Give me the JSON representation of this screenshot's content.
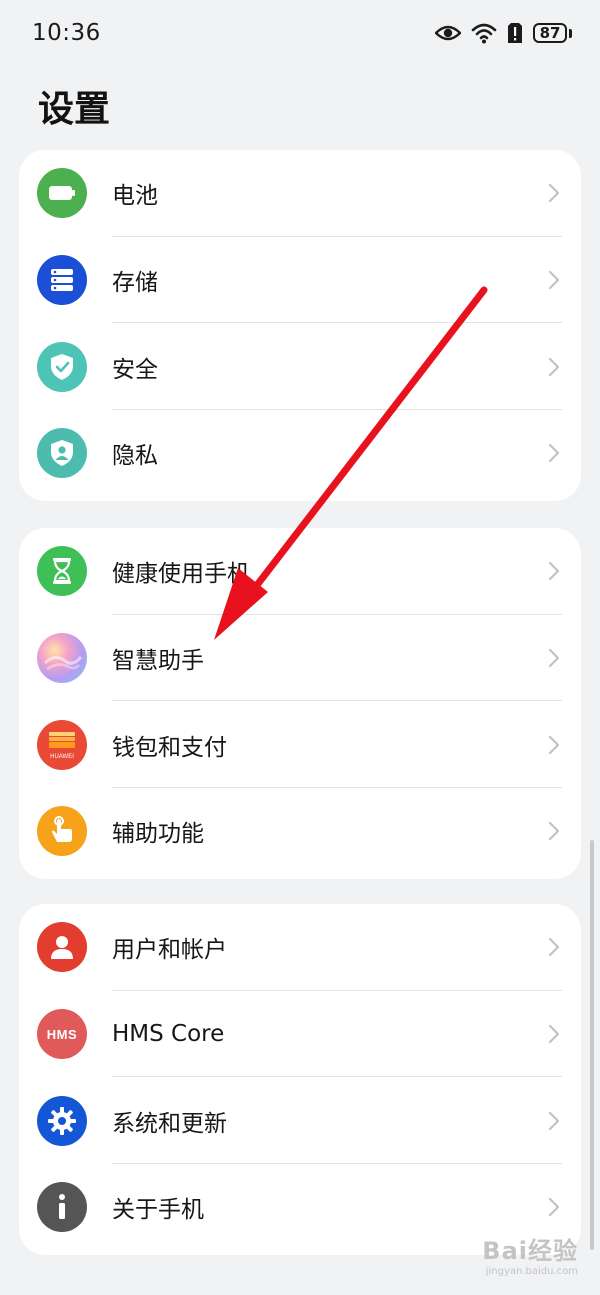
{
  "status_bar": {
    "time": "10:36",
    "battery_level": "87",
    "icons": [
      "eye-icon",
      "wifi-icon",
      "alert-icon",
      "battery-icon"
    ]
  },
  "page": {
    "title": "设置"
  },
  "groups": [
    {
      "items": [
        {
          "label": "电池",
          "icon": "battery-icon",
          "color": "#4cb050"
        },
        {
          "label": "存储",
          "icon": "storage-icon",
          "color": "#1a4fd6"
        },
        {
          "label": "安全",
          "icon": "shield-check-icon",
          "color": "#4dc4b5"
        },
        {
          "label": "隐私",
          "icon": "privacy-shield-icon",
          "color": "#4cbcae"
        }
      ]
    },
    {
      "items": [
        {
          "label": "健康使用手机",
          "icon": "hourglass-icon",
          "color": "#3fc057"
        },
        {
          "label": "智慧助手",
          "icon": "smart-assistant-icon",
          "color": "#c9a0f0"
        },
        {
          "label": "钱包和支付",
          "icon": "huawei-wallet-icon",
          "color": "#e84a35",
          "badge": "HUAWEI"
        },
        {
          "label": "辅助功能",
          "icon": "accessibility-hand-icon",
          "color": "#f7a21b"
        }
      ]
    },
    {
      "items": [
        {
          "label": "用户和帐户",
          "icon": "user-icon",
          "color": "#e23d2e"
        },
        {
          "label": "HMS Core",
          "icon": "hms-core-icon",
          "color": "#e05a5a",
          "badge": "HMS"
        },
        {
          "label": "系统和更新",
          "icon": "gear-icon",
          "color": "#1457d6"
        },
        {
          "label": "关于手机",
          "icon": "info-icon",
          "color": "#555555"
        }
      ]
    }
  ],
  "annotation": {
    "color": "#e8121e"
  },
  "watermark": {
    "main": "Bai经验",
    "sub": "jingyan.baidu.com"
  }
}
